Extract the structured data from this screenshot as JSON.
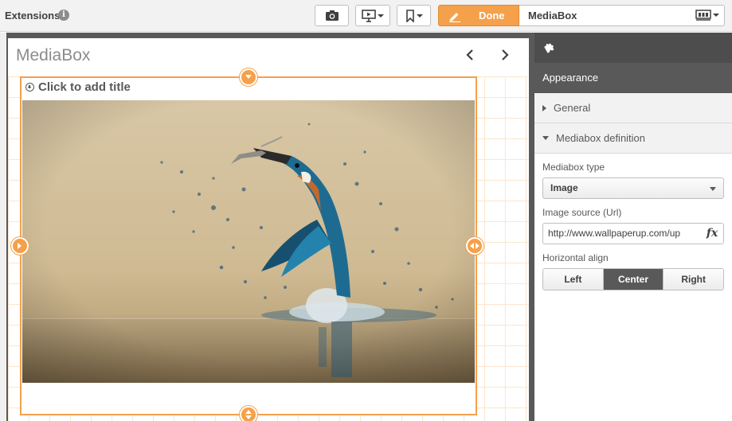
{
  "toolbar": {
    "extensions_label": "Extensions",
    "done_label": "Done",
    "sheet_title": "MediaBox",
    "icons": [
      "info-icon",
      "camera-icon",
      "presentation-icon",
      "bookmark-icon",
      "pencil-icon",
      "sheets-icon"
    ]
  },
  "sheet": {
    "name": "MediaBox"
  },
  "object": {
    "title_placeholder": "Click to add title",
    "image_description": "kingfisher-photo"
  },
  "panel": {
    "section": "Appearance",
    "accordion": [
      {
        "label": "General",
        "expanded": false
      },
      {
        "label": "Mediabox definition",
        "expanded": true
      }
    ],
    "mediabox_type_label": "Mediabox type",
    "mediabox_type_value": "Image",
    "image_source_label": "Image source (Url)",
    "image_source_value": "http://www.wallpaperup.com/up",
    "fx_label": "fx",
    "halign_label": "Horizontal align",
    "halign_options": [
      "Left",
      "Center",
      "Right"
    ],
    "halign_selected": "Center"
  },
  "colors": {
    "accent": "#f5a04b",
    "panel_dark": "#4d4d4d",
    "panel_sub": "#595959"
  }
}
